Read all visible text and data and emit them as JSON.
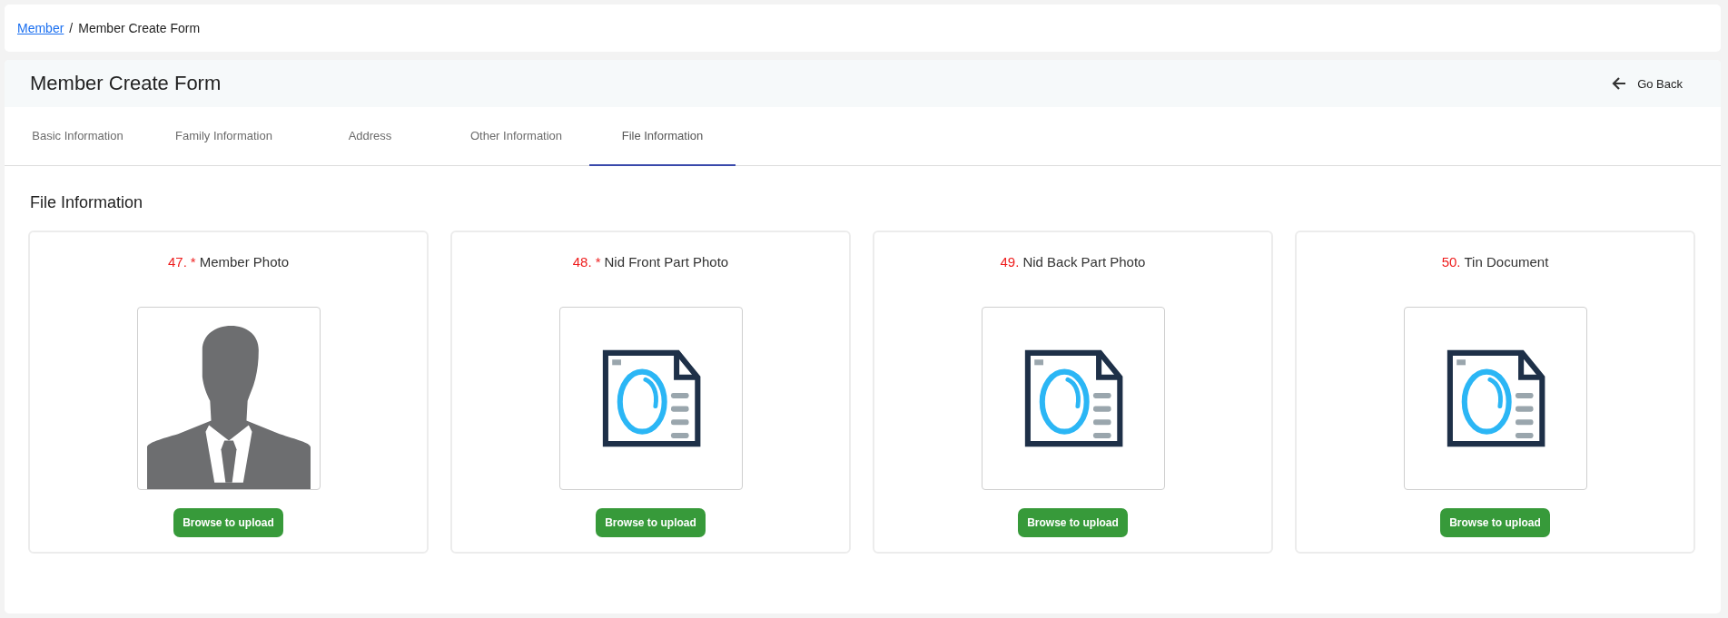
{
  "breadcrumb": {
    "link": "Member",
    "separator": "/",
    "current": "Member Create Form"
  },
  "header": {
    "title": "Member Create Form",
    "back_button": "Go Back"
  },
  "tabs": [
    {
      "label": "Basic Information",
      "selected": false
    },
    {
      "label": "Family Information",
      "selected": false
    },
    {
      "label": "Address",
      "selected": false
    },
    {
      "label": "Other Information",
      "selected": false
    },
    {
      "label": "File Information",
      "selected": true
    }
  ],
  "section_title": "File Information",
  "file_cards": [
    {
      "number": "47.",
      "required_mark": "*",
      "label": "Member Photo",
      "kind": "person",
      "button": "Browse to upload"
    },
    {
      "number": "48.",
      "required_mark": "*",
      "label": "Nid Front Part Photo",
      "kind": "document",
      "button": "Browse to upload"
    },
    {
      "number": "49.",
      "label": "Nid Back Part Photo",
      "kind": "document",
      "button": "Browse to upload"
    },
    {
      "number": "50.",
      "label": "Tin Document",
      "kind": "document",
      "button": "Browse to upload"
    }
  ]
}
